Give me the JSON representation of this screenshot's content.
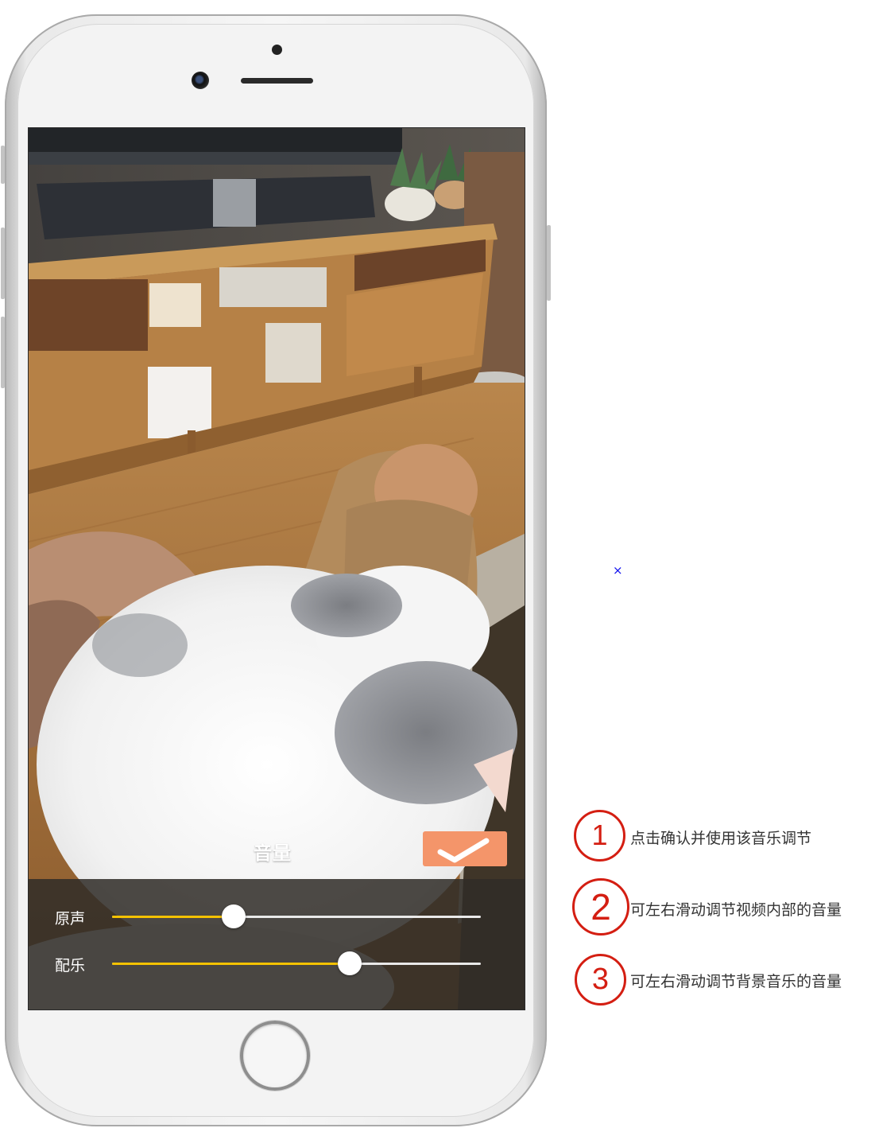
{
  "screen": {
    "volume_title": "音量",
    "confirm_icon": "check-icon",
    "sliders": [
      {
        "label": "原声",
        "value": 0.33
      },
      {
        "label": "配乐",
        "value": 0.645
      }
    ]
  },
  "annotations": [
    {
      "number": "1",
      "text": "点击确认并使用该音乐调节"
    },
    {
      "number": "2",
      "text": "可左右滑动调节视频内部的音量"
    },
    {
      "number": "3",
      "text": "可左右滑动调节背景音乐的音量"
    }
  ],
  "marker": "×",
  "colors": {
    "accent_orange": "#f4956a",
    "slider_fill": "#f4c200",
    "annotation_red": "#d41e12",
    "marker_blue": "#1010ee"
  }
}
